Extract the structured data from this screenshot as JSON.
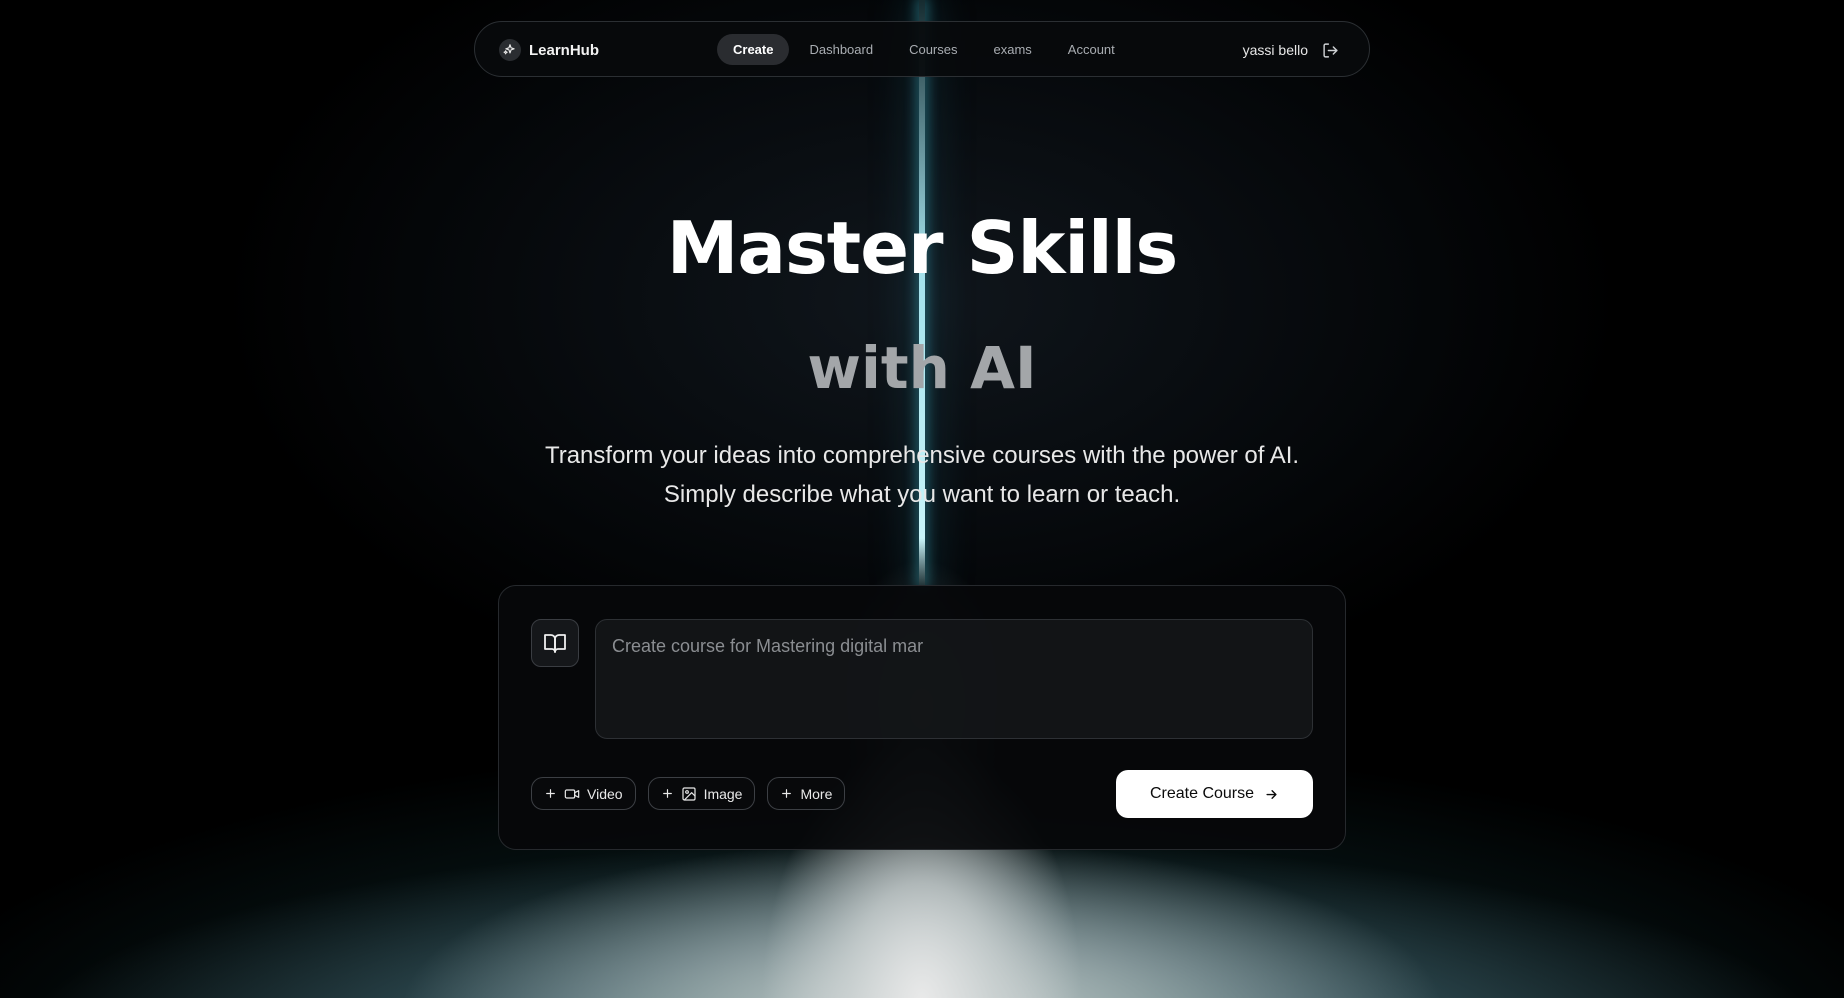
{
  "nav": {
    "brand": "LearnHub",
    "links": [
      {
        "label": "Create",
        "active": true
      },
      {
        "label": "Dashboard",
        "active": false
      },
      {
        "label": "Courses",
        "active": false
      },
      {
        "label": "exams",
        "active": false
      },
      {
        "label": "Account",
        "active": false
      }
    ],
    "user_name": "yassi bello",
    "icons": {
      "brand": "sparkle-icon",
      "logout": "logout-icon"
    }
  },
  "hero": {
    "title": "Master Skills",
    "subtitle": "with AI",
    "description": "Transform your ideas into comprehensive courses with the power of AI. Simply describe what you want to learn or teach."
  },
  "composer": {
    "input_value": "",
    "input_placeholder": "Create course for Mastering digital mar",
    "book_icon": "book-open-icon",
    "chips": [
      {
        "label": "Video",
        "icon": "video-icon"
      },
      {
        "label": "Image",
        "icon": "image-icon"
      },
      {
        "label": "More",
        "icon": ""
      }
    ],
    "submit_label": "Create Course",
    "submit_icon": "arrow-right-icon"
  },
  "colors": {
    "background": "#000000",
    "accent_beam": "#9fe6f0",
    "button_bg": "#ffffff",
    "active_tab_bg": "#2a2c30"
  }
}
